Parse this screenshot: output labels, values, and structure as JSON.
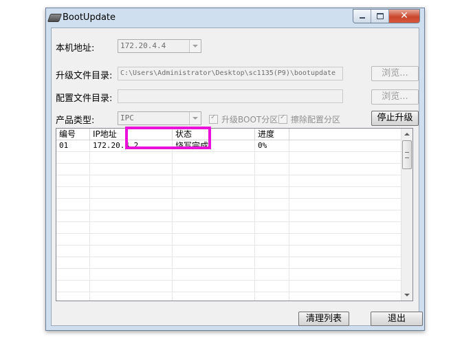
{
  "window": {
    "title": "BootUpdate",
    "icon": "app-icon",
    "controls": [
      "minimize-icon",
      "maximize-icon",
      "close-icon"
    ]
  },
  "form": {
    "local_address_label": "本机地址:",
    "local_address_value": "172.20.4.4",
    "upgrade_dir_label": "升级文件目录:",
    "upgrade_dir_value": "C:\\Users\\Administrator\\Desktop\\sc1135(P9)\\bootupdate",
    "browse_label": "浏览...",
    "config_dir_label": "配置文件目录:",
    "config_dir_value": "",
    "browse2_label": "浏览...",
    "product_type_label": "产品类型:",
    "product_type_value": "IPC",
    "upgrade_boot_label": "升级BOOT分区",
    "upgrade_boot_checked": true,
    "erase_config_label": "擦除配置分区",
    "erase_config_checked": true,
    "stop_upgrade_label": "停止升级"
  },
  "list": {
    "columns": [
      "编号",
      "IP地址",
      "状态",
      "进度"
    ],
    "rows": [
      [
        "01",
        "172.20.4.2",
        "烧写完成",
        "0%"
      ]
    ]
  },
  "footer": {
    "clear_list_label": "清理列表",
    "exit_label": "退出"
  },
  "colors": {
    "highlight": "#ec11d8",
    "window_frame": "#cfdff0",
    "client_bg": "#f0f0f0"
  }
}
